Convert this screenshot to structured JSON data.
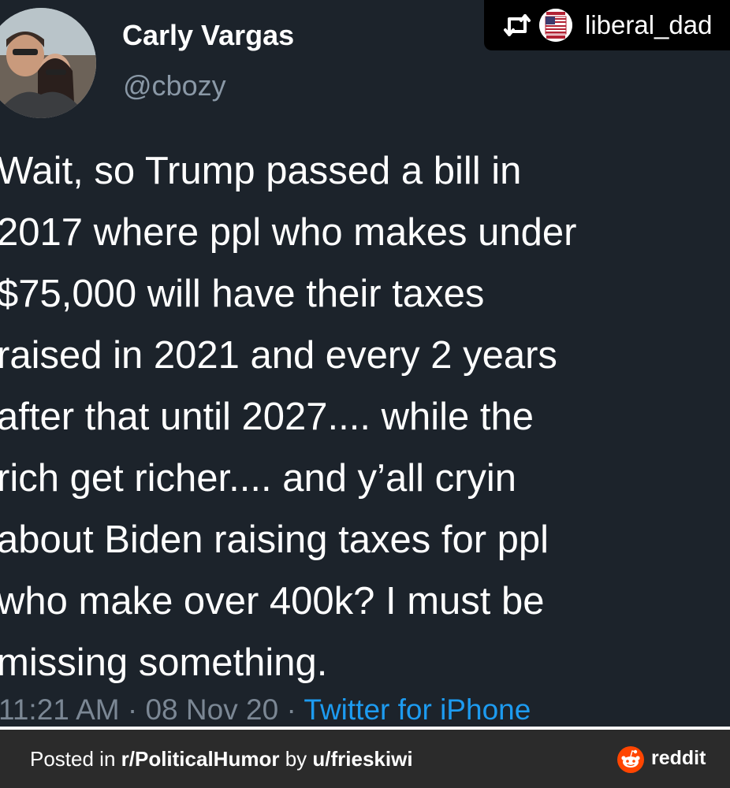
{
  "tweet": {
    "author_name": "Carly Vargas",
    "author_handle": "@cbozy",
    "text_lines": [
      "Wait, so Trump passed a bill in",
      "2017 where ppl who makes under",
      "$75,000 will have their taxes",
      "raised in 2021 and every 2 years",
      "after that until 2027.... while the",
      "rich get richer.... and y’all cryin",
      "about Biden raising taxes for ppl",
      "who make over 400k? I must be",
      "missing something."
    ],
    "time": "11:21 AM",
    "date": "08 Nov 20",
    "separator": "·",
    "source": "Twitter for iPhone"
  },
  "repost": {
    "icon": "repost-icon",
    "username": "liberal_dad"
  },
  "footer": {
    "prefix": "Posted in ",
    "subreddit": "r/PoliticalHumor",
    "by": " by ",
    "user": "u/frieskiwi",
    "brand": "reddit"
  },
  "colors": {
    "background": "#1c232b",
    "text": "#ffffff",
    "muted": "#8a98a6",
    "link": "#1d9bf0",
    "footer_bg": "#2b2b2b",
    "reddit_orange": "#ff4500"
  }
}
